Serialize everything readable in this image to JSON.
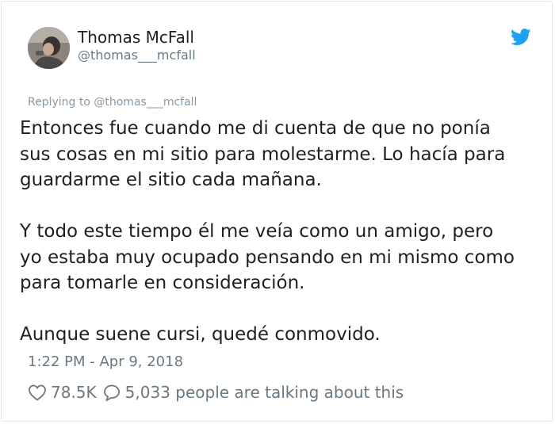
{
  "author": {
    "name": "Thomas McFall",
    "handle": "@thomas___mcfall"
  },
  "replying_to": "Replying to @thomas___mcfall",
  "tweet_lines": [
    "Entonces fue cuando me di cuenta de que no ponía",
    "sus cosas en mi sitio para molestarme. Lo hacía para",
    "guardarme el sitio cada mañana.",
    "",
    "Y todo este tiempo él me veía como un amigo, pero",
    "yo estaba muy ocupado pensando en mi mismo como",
    "para tomarle en consideración.",
    "",
    "Aunque suene cursi, quedé conmovido."
  ],
  "timestamp": "1:22 PM - Apr 9, 2018",
  "likes": "78.5K",
  "talking": "5,033 people are talking about this",
  "colors": {
    "twitter_blue": "#1da1f2",
    "secondary_text": "#697882"
  },
  "icons": [
    "twitter-bird-icon",
    "heart-icon",
    "reply-bubble-icon"
  ]
}
